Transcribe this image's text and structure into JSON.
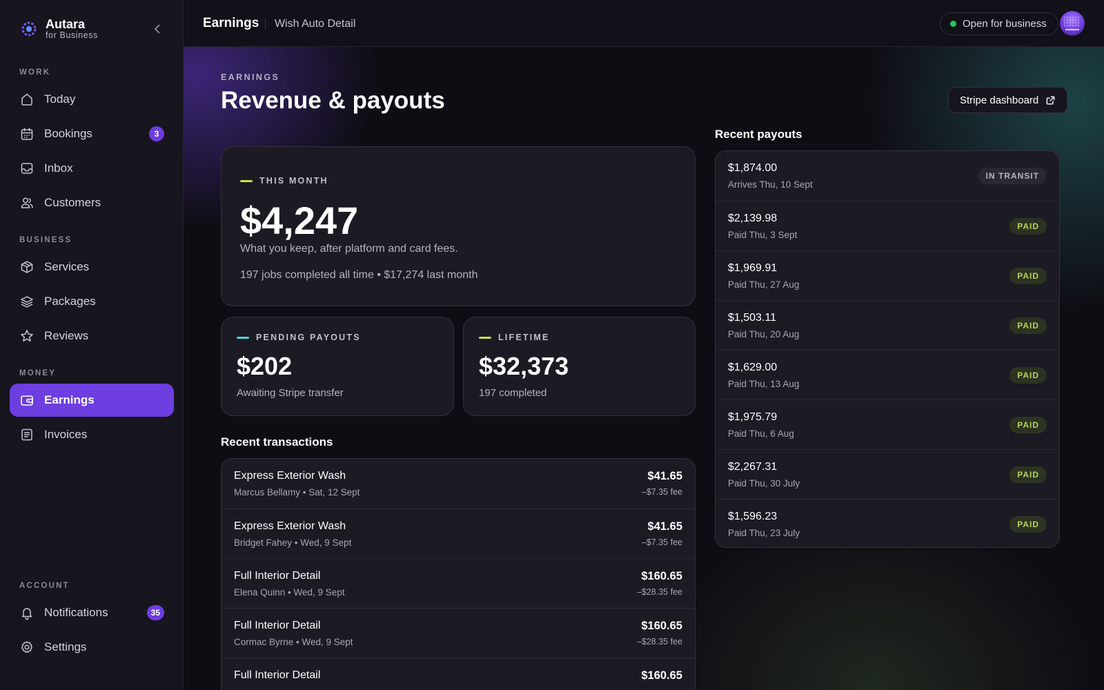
{
  "brand": {
    "name": "Autara",
    "sub": "for Business"
  },
  "sidebar": {
    "sections": {
      "work": "WORK",
      "business": "BUSINESS",
      "money": "MONEY",
      "account": "ACCOUNT"
    },
    "items": [
      {
        "label": "Today",
        "icon": "home-icon"
      },
      {
        "label": "Bookings",
        "icon": "calendar-icon",
        "badge": "3"
      },
      {
        "label": "Inbox",
        "icon": "inbox-icon"
      },
      {
        "label": "Customers",
        "icon": "users-icon"
      },
      {
        "label": "Services",
        "icon": "box-icon"
      },
      {
        "label": "Packages",
        "icon": "layers-icon"
      },
      {
        "label": "Reviews",
        "icon": "star-icon"
      },
      {
        "label": "Earnings",
        "icon": "wallet-icon",
        "active": true
      },
      {
        "label": "Invoices",
        "icon": "document-icon"
      },
      {
        "label": "Notifications",
        "icon": "bell-icon",
        "badge": "35"
      },
      {
        "label": "Settings",
        "icon": "gear-icon"
      }
    ]
  },
  "topbar": {
    "title": "Earnings",
    "subtitle": "Wish Auto Detail",
    "status": "Open for business"
  },
  "page": {
    "eyebrow": "EARNINGS",
    "title": "Revenue & payouts",
    "stripe_button": "Stripe dashboard"
  },
  "this_month": {
    "label": "THIS MONTH",
    "amount": "$4,247",
    "note": "What you keep, after platform and card fees.",
    "stats": "197 jobs completed all time • $17,274 last month"
  },
  "pending": {
    "label": "PENDING PAYOUTS",
    "amount": "$202",
    "note": "Awaiting Stripe transfer"
  },
  "lifetime": {
    "label": "LIFETIME",
    "amount": "$32,373",
    "note": "197 completed"
  },
  "transactions": {
    "title": "Recent transactions",
    "rows": [
      {
        "name": "Express Exterior Wash",
        "meta": "Marcus Bellamy • Sat, 12 Sept",
        "amount": "$41.65",
        "fee": "–$7.35 fee"
      },
      {
        "name": "Express Exterior Wash",
        "meta": "Bridget Fahey • Wed, 9 Sept",
        "amount": "$41.65",
        "fee": "–$7.35 fee"
      },
      {
        "name": "Full Interior Detail",
        "meta": "Elena Quinn • Wed, 9 Sept",
        "amount": "$160.65",
        "fee": "–$28.35 fee"
      },
      {
        "name": "Full Interior Detail",
        "meta": "Cormac Byrne • Wed, 9 Sept",
        "amount": "$160.65",
        "fee": "–$28.35 fee"
      },
      {
        "name": "Full Interior Detail",
        "meta": "",
        "amount": "$160.65",
        "fee": ""
      }
    ]
  },
  "payouts": {
    "title": "Recent payouts",
    "rows": [
      {
        "amount": "$1,874.00",
        "date": "Arrives Thu, 10 Sept",
        "status": "IN TRANSIT"
      },
      {
        "amount": "$2,139.98",
        "date": "Paid Thu, 3 Sept",
        "status": "PAID"
      },
      {
        "amount": "$1,969.91",
        "date": "Paid Thu, 27 Aug",
        "status": "PAID"
      },
      {
        "amount": "$1,503.11",
        "date": "Paid Thu, 20 Aug",
        "status": "PAID"
      },
      {
        "amount": "$1,629.00",
        "date": "Paid Thu, 13 Aug",
        "status": "PAID"
      },
      {
        "amount": "$1,975.79",
        "date": "Paid Thu, 6 Aug",
        "status": "PAID"
      },
      {
        "amount": "$2,267.31",
        "date": "Paid Thu, 30 July",
        "status": "PAID"
      },
      {
        "amount": "$1,596.23",
        "date": "Paid Thu, 23 July",
        "status": "PAID"
      }
    ]
  },
  "colors": {
    "accent": "#6d3ee0",
    "this_month_dash": "#c6e34a",
    "pending_dash": "#4dd6e0",
    "lifetime_dash": "#c6e34a",
    "status_dot": "#22c55e"
  }
}
